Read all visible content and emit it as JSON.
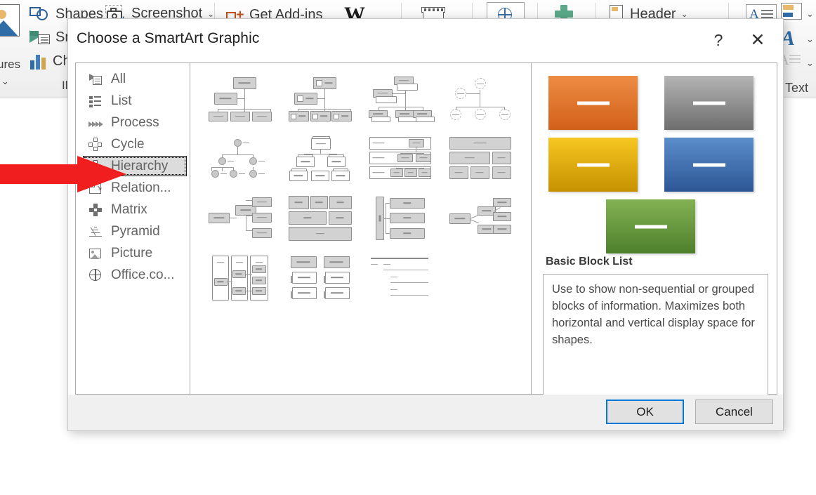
{
  "ribbon": {
    "items": [
      {
        "label": "Shapes",
        "icon": "shapes-icon",
        "caret": "⌄"
      },
      {
        "label": "Screenshot",
        "icon": "screenshot-camera-icon",
        "caret": "⌄"
      },
      {
        "label": "Get Add-ins",
        "icon": "get-addins-icon",
        "caret": ""
      },
      {
        "label": "Smart",
        "icon": "smartart-icon",
        "caret": ""
      },
      {
        "label": "Chart",
        "icon": "chart-icon",
        "caret": ""
      },
      {
        "label": "Header",
        "icon": "header-page-icon",
        "caret": "⌄"
      }
    ],
    "pictures_label": "ures",
    "illustrations_label": "Il",
    "wikipedia_label": "W",
    "text_group_label": "Text",
    "caret_glyph": "⌄"
  },
  "dialog": {
    "title": "Choose a SmartArt Graphic",
    "help_label": "?",
    "close_label": "✕",
    "categories": [
      {
        "label": "All",
        "icon": "all-icon",
        "selected": false
      },
      {
        "label": "List",
        "icon": "list-icon",
        "selected": false
      },
      {
        "label": "Process",
        "icon": "process-icon",
        "selected": false
      },
      {
        "label": "Cycle",
        "icon": "cycle-icon",
        "selected": false
      },
      {
        "label": "Hierarchy",
        "icon": "hierarchy-icon",
        "selected": true
      },
      {
        "label": "Relation...",
        "icon": "relationship-icon",
        "selected": false
      },
      {
        "label": "Matrix",
        "icon": "matrix-icon",
        "selected": false
      },
      {
        "label": "Pyramid",
        "icon": "pyramid-icon",
        "selected": false
      },
      {
        "label": "Picture",
        "icon": "picture-icon",
        "selected": false
      },
      {
        "label": "Office.co...",
        "icon": "office-com-globe-icon",
        "selected": false
      }
    ],
    "gallery": {
      "rows": [
        [
          "organization-chart",
          "picture-organization-chart",
          "name-and-title-organization-chart",
          "circle-picture-hierarchy"
        ],
        [
          "half-circle-organization-chart",
          "labeled-hierarchy",
          "table-hierarchy",
          "horizontal-multi-level-hierarchy"
        ],
        [
          "hierarchy-list",
          "architecture-layout",
          "horizontal-hierarchy",
          "horizontal-labeled-hierarchy"
        ],
        [
          "table-hierarchy-alt",
          "lined-list",
          "hierarchy-lines"
        ]
      ]
    },
    "preview": {
      "title": "Basic Block List",
      "description": "Use to show non-sequential or grouped blocks of information. Maximizes both horizontal and vertical display space for shapes.",
      "blocks": [
        {
          "name": "orange-block",
          "color_top": "#ed8c43",
          "color_bottom": "#d2601a"
        },
        {
          "name": "gray-block",
          "color_top": "#b4b4b4",
          "color_bottom": "#6e6e6e"
        },
        {
          "name": "yellow-block",
          "color_top": "#f6c721",
          "color_bottom": "#c69100"
        },
        {
          "name": "blue-block",
          "color_top": "#5b8ecb",
          "color_bottom": "#2d5695"
        },
        {
          "name": "green-block",
          "color_top": "#83b254",
          "color_bottom": "#4e7f2b"
        }
      ]
    },
    "buttons": {
      "ok": "OK",
      "cancel": "Cancel"
    }
  },
  "annotation": {
    "arrow_color": "#f01e1e",
    "points_to": "Hierarchy"
  }
}
